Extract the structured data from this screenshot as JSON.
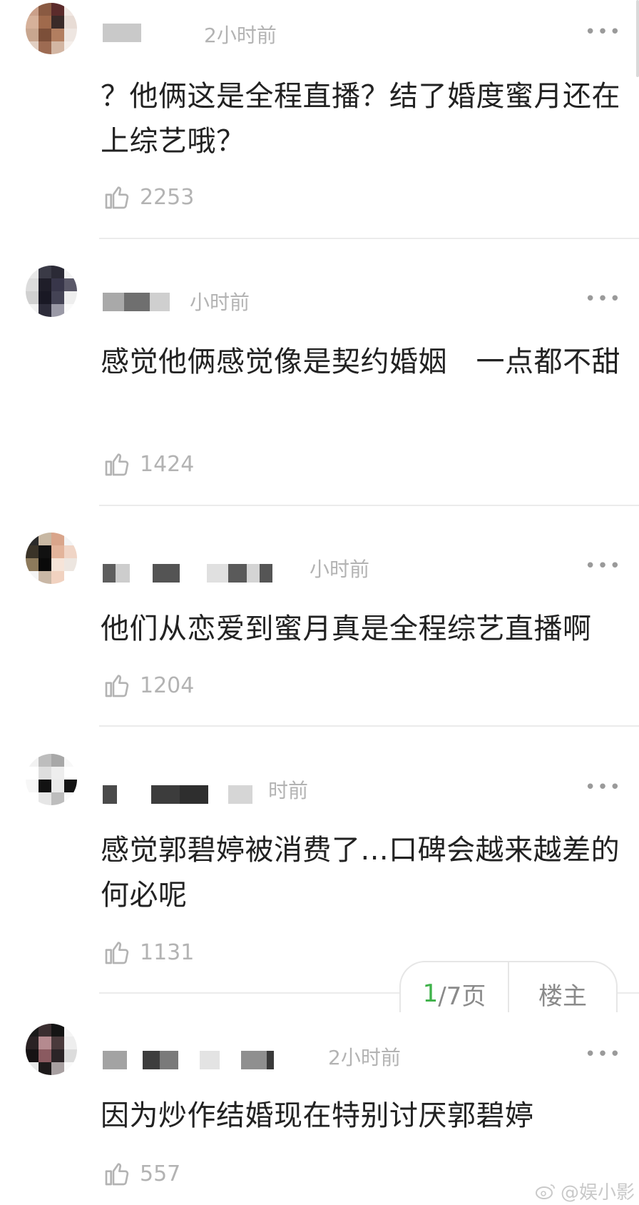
{
  "comments": [
    {
      "time": "2小时前",
      "text": "？他俩这是全程直播？结了婚度蜜月还在上综艺哦？",
      "likes": "2253"
    },
    {
      "time": "小时前",
      "text": "感觉他俩感觉像是契约婚姻　一点都不甜",
      "likes": "1424"
    },
    {
      "time": "小时前",
      "text": "他们从恋爱到蜜月真是全程综艺直播啊",
      "likes": "1204"
    },
    {
      "time": "时前",
      "text": "感觉郭碧婷被消费了...口碑会越来越差的 何必呢",
      "likes": "1131"
    },
    {
      "time": "2小时前",
      "text": "因为炒作结婚现在特别讨厌郭碧婷",
      "likes": "557"
    }
  ],
  "more_label": "•••",
  "pager": {
    "current": "1",
    "rest": "/7页",
    "owner_label": "楼主"
  },
  "watermark": "@娱小影",
  "icons": {
    "like": "thumbs-up-icon",
    "more": "more-dots-icon",
    "weibo": "weibo-logo-icon"
  },
  "colors": {
    "accent": "#3fb24a",
    "text": "#222222",
    "muted": "#b3b3b3"
  }
}
